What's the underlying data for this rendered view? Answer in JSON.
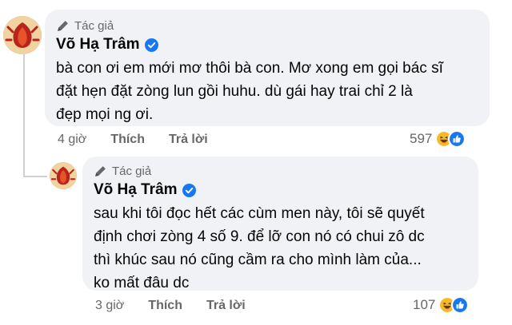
{
  "comments": [
    {
      "badge": "Tác giả",
      "author": "Võ Hạ Trâm",
      "text": "bà con ơi em mới mơ thôi bà con. Mơ xong em gọi bác sĩ\nđặt hẹn đặt zòng lun gồi huhu. dù gái hay trai chỉ 2 là\nđẹp mọi ng ơi.",
      "time": "4 giờ",
      "like_label": "Thích",
      "reply_label": "Trả lời",
      "reaction_count": "597"
    },
    {
      "badge": "Tác giả",
      "author": "Võ Hạ Trâm",
      "text": "sau khi tôi đọc hết các cùm men này, tôi sẽ quyết\nđịnh chơi zòng 4 số 9. để lỡ con nó có chui zô dc\nthì khúc sau nó cũng cầm ra cho mình làm của...\nko mất đâu dc",
      "time": "3 giờ",
      "like_label": "Thích",
      "reply_label": "Trả lời",
      "reaction_count": "107"
    }
  ],
  "colors": {
    "bubble_bg": "#f0f2f5",
    "verified_blue": "#1877f2",
    "haha_yellow": "#f7b928",
    "like_blue": "#1877f2",
    "muted_text": "#65676b"
  },
  "icons": [
    "pencil-icon",
    "verified-badge-icon",
    "haha-reaction-icon",
    "like-reaction-icon"
  ]
}
